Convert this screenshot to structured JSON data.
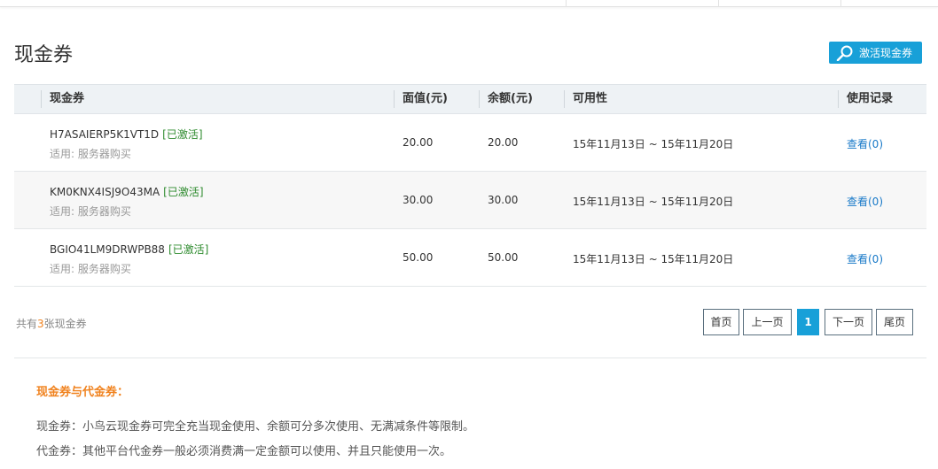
{
  "page": {
    "title": "现金券"
  },
  "toolbar": {
    "activate_label": "激活现金券"
  },
  "table": {
    "columns": [
      "现金券",
      "面值(元)",
      "余额(元)",
      "可用性",
      "使用记录"
    ],
    "rows": [
      {
        "code": "H7ASAIERP5K1VT1D",
        "status": "[已激活]",
        "scope": "适用: 服务器购买",
        "face_value": "20.00",
        "balance": "20.00",
        "validity": "15年11月13日 ~ 15年11月20日",
        "record": "查看(0)"
      },
      {
        "code": "KM0KNX4ISJ9O43MA",
        "status": "[已激活]",
        "scope": "适用: 服务器购买",
        "face_value": "30.00",
        "balance": "30.00",
        "validity": "15年11月13日 ~ 15年11月20日",
        "record": "查看(0)"
      },
      {
        "code": "BGIO41LM9DRWPB88",
        "status": "[已激活]",
        "scope": "适用: 服务器购买",
        "face_value": "50.00",
        "balance": "50.00",
        "validity": "15年11月13日 ~ 15年11月20日",
        "record": "查看(0)"
      }
    ]
  },
  "footer": {
    "count_prefix": "共有",
    "count": "3",
    "count_suffix": "张现金券"
  },
  "pagination": {
    "first": "首页",
    "prev": "上一页",
    "current": "1",
    "next": "下一页",
    "last": "尾页"
  },
  "info": {
    "title": "现金券与代金券：",
    "line1": "现金券：小鸟云现金券可完全充当现金使用、余额可分多次使用、无满减条件等限制。",
    "line2": "代金券：其他平台代金券一般必须消费满一定金额可以使用、并且只能使用一次。"
  },
  "colors": {
    "accent": "#18a0d8",
    "status_green": "#2e8b2e",
    "highlight_orange": "#f0821e",
    "link_blue": "#1879c8"
  }
}
